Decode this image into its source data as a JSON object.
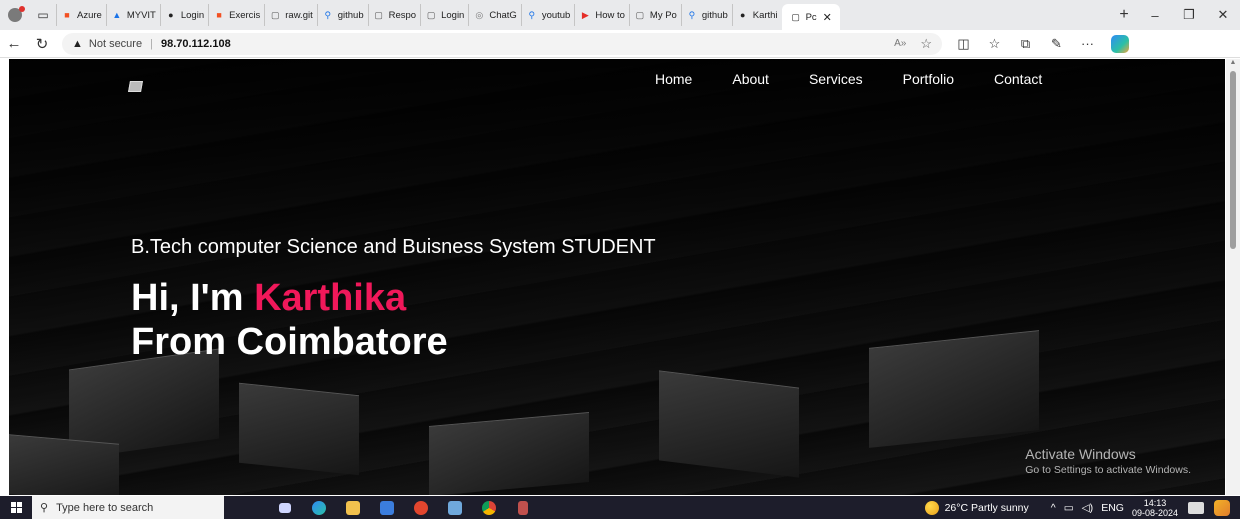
{
  "browser": {
    "tabs": [
      {
        "label": "Azure",
        "icon": "microsoft-icon"
      },
      {
        "label": "MYVIT",
        "icon": "myvit-icon"
      },
      {
        "label": "Login",
        "icon": "github-icon"
      },
      {
        "label": "Exercis",
        "icon": "microsoft-icon"
      },
      {
        "label": "raw.git",
        "icon": "page-icon"
      },
      {
        "label": "github",
        "icon": "search-icon"
      },
      {
        "label": "Respo",
        "icon": "page-icon"
      },
      {
        "label": "Login",
        "icon": "page-icon"
      },
      {
        "label": "ChatG",
        "icon": "chatgpt-icon"
      },
      {
        "label": "youtub",
        "icon": "search-icon"
      },
      {
        "label": "How to",
        "icon": "youtube-icon"
      },
      {
        "label": "My Po",
        "icon": "page-icon"
      },
      {
        "label": "github",
        "icon": "search-icon"
      },
      {
        "label": "Karthi",
        "icon": "github-icon"
      }
    ],
    "active_tab": {
      "label": "Pc",
      "icon": "page-icon"
    },
    "address": {
      "security_text": "Not secure",
      "url": "98.70.112.108"
    }
  },
  "site": {
    "nav": [
      "Home",
      "About",
      "Services",
      "Portfolio",
      "Contact"
    ],
    "hero": {
      "subtitle": "B.Tech computer Science and Buisness System STUDENT",
      "greeting": "Hi, I'm ",
      "name": "Karthika",
      "line2": "From Coimbatore"
    },
    "accent_color": "#f0185a"
  },
  "watermark": {
    "title": "Activate Windows",
    "subtitle": "Go to Settings to activate Windows."
  },
  "taskbar": {
    "search_placeholder": "Type here to search",
    "weather": "26°C  Partly sunny",
    "language": "ENG",
    "time": "14:13",
    "date": "09-08-2024"
  }
}
